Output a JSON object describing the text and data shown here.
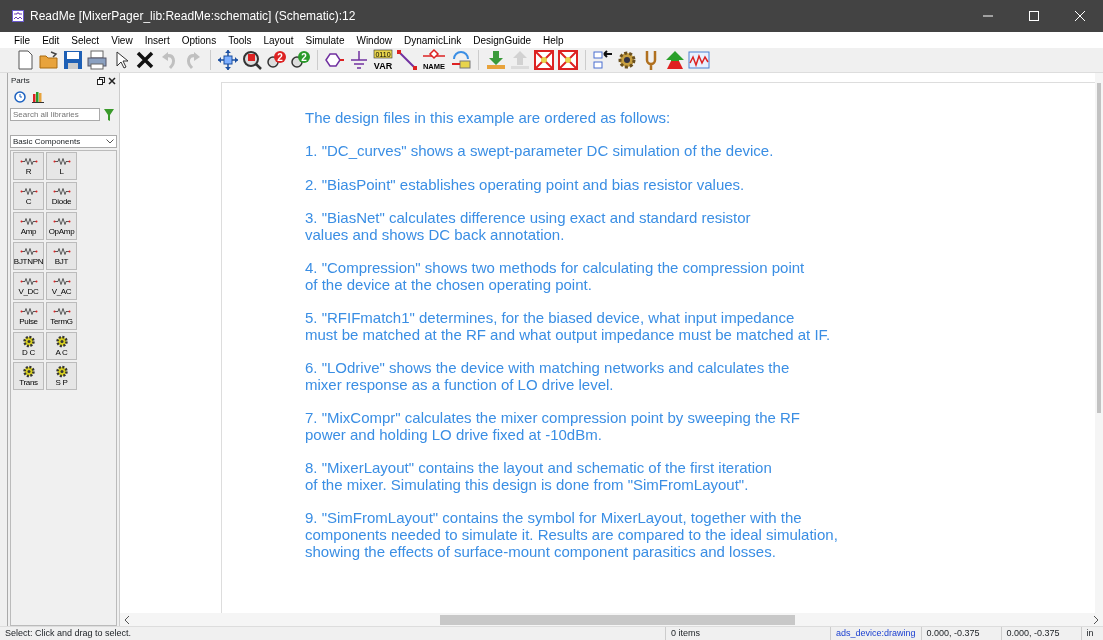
{
  "window": {
    "title": "ReadMe [MixerPager_lib:ReadMe:schematic] (Schematic):12"
  },
  "menu": [
    "File",
    "Edit",
    "Select",
    "View",
    "Insert",
    "Options",
    "Tools",
    "Layout",
    "Simulate",
    "Window",
    "DynamicLink",
    "DesignGuide",
    "Help"
  ],
  "toolbar": [
    {
      "kind": "new"
    },
    {
      "kind": "open"
    },
    {
      "kind": "save"
    },
    {
      "kind": "print"
    },
    {
      "kind": "pointer"
    },
    {
      "kind": "delete"
    },
    {
      "kind": "undo",
      "disabled": true
    },
    {
      "kind": "redo",
      "disabled": true
    },
    {
      "kind": "sep"
    },
    {
      "kind": "pan"
    },
    {
      "kind": "zoomwin"
    },
    {
      "kind": "zoomin",
      "label": "2"
    },
    {
      "kind": "zoomout",
      "label": "2"
    },
    {
      "kind": "sep"
    },
    {
      "kind": "port"
    },
    {
      "kind": "ground"
    },
    {
      "kind": "var",
      "label": "0110",
      "label2": "VAR"
    },
    {
      "kind": "wire"
    },
    {
      "kind": "name",
      "label": "NAME"
    },
    {
      "kind": "swap"
    },
    {
      "kind": "sep"
    },
    {
      "kind": "down"
    },
    {
      "kind": "up",
      "disabled": true
    },
    {
      "kind": "xbox"
    },
    {
      "kind": "xbox"
    },
    {
      "kind": "sep"
    },
    {
      "kind": "list"
    },
    {
      "kind": "gear"
    },
    {
      "kind": "fork"
    },
    {
      "kind": "arrowup"
    },
    {
      "kind": "graph"
    }
  ],
  "parts_panel": {
    "title": "Parts",
    "search": {
      "placeholder": "Search all libraries"
    },
    "library": "Basic Components",
    "items": [
      {
        "label": "R",
        "kind": "component"
      },
      {
        "label": "L",
        "kind": "component"
      },
      {
        "label": "C",
        "kind": "component"
      },
      {
        "label": "Diode",
        "kind": "component"
      },
      {
        "label": "Amp",
        "kind": "component"
      },
      {
        "label": "OpAmp",
        "kind": "component"
      },
      {
        "label": "BJTNPN",
        "kind": "component"
      },
      {
        "label": "BJT",
        "kind": "component"
      },
      {
        "label": "V_DC",
        "kind": "component"
      },
      {
        "label": "V_AC",
        "kind": "component"
      },
      {
        "label": "Pulse",
        "kind": "component"
      },
      {
        "label": "TermG",
        "kind": "component"
      },
      {
        "label": "D C",
        "kind": "simulation"
      },
      {
        "label": "A C",
        "kind": "simulation"
      },
      {
        "label": "Trans",
        "kind": "simulation"
      },
      {
        "label": "S P",
        "kind": "simulation"
      }
    ]
  },
  "document": {
    "paragraphs": [
      [
        "The design files in this example are ordered as follows:"
      ],
      [
        "1. \"DC_curves\" shows a swept-parameter DC simulation of the device."
      ],
      [
        "2. \"BiasPoint\" establishes operating point and bias resistor values."
      ],
      [
        "3. \"BiasNet\" calculates difference using exact and standard resistor",
        "values and shows DC back annotation."
      ],
      [
        "4. \"Compression\" shows two methods for calculating the compression point",
        "of the device at the chosen operating point."
      ],
      [
        "5. \"RFIFmatch1\" determines, for the biased device, what input impedance",
        "must be matched at the RF and what output impedance must be matched at IF."
      ],
      [
        "6. \"LOdrive\" shows the device with matching networks and calculates the",
        "mixer response as a function of LO drive level."
      ],
      [
        "7. \"MixCompr\" calculates the mixer compression point by sweeping the RF",
        "power and holding LO drive fixed at -10dBm."
      ],
      [
        "8. \"MixerLayout\" contains the layout and schematic of the first iteration",
        "of the mixer. Simulating this design is done from \"SimFromLayout\"."
      ],
      [
        "9. \"SimFromLayout\" contains the symbol for MixerLayout, together with the",
        "components needed to simulate it. Results are compared to the ideal simulation,",
        "showing the effects of surface-mount component parasitics and losses."
      ]
    ]
  },
  "status_bar": {
    "message": "Select: Click and drag to select.",
    "items": "0 items",
    "layer": "ads_device:drawing",
    "coord_1": "0.000, -0.375",
    "coord_2": "0.000, -0.375",
    "units": "in"
  }
}
